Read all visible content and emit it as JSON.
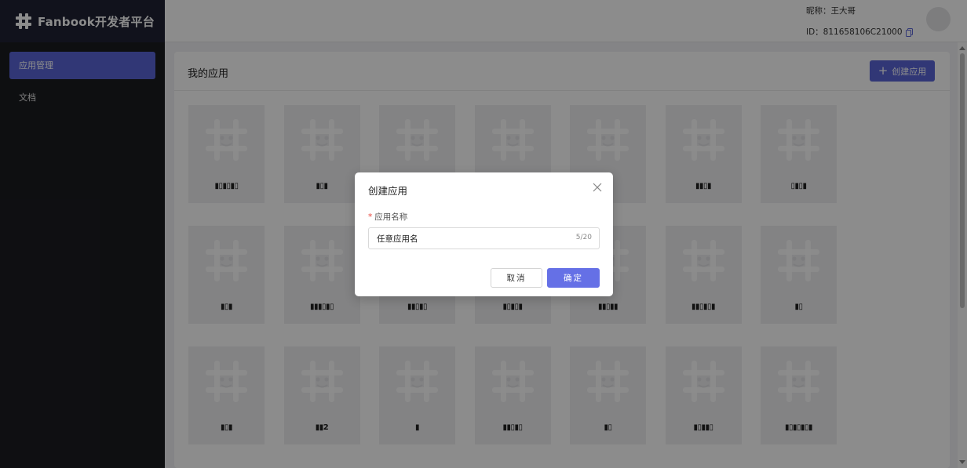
{
  "app": {
    "brand": "Fanbook开发者平台"
  },
  "sidebar": {
    "items": [
      {
        "label": "应用管理",
        "active": true
      },
      {
        "label": "文档",
        "active": false
      }
    ]
  },
  "header": {
    "nickname": "昵称：王大哥",
    "user_id": "ID：811658106C21000"
  },
  "main": {
    "title": "我的应用",
    "create_button": "创建应用",
    "apps": [
      {
        "name": "▮▯▮▯▮▯",
        "pixelated": true
      },
      {
        "name": "▮▯▮",
        "pixelated": true
      },
      {
        "name": "",
        "pixelated": true
      },
      {
        "name": "",
        "pixelated": true
      },
      {
        "name": "",
        "pixelated": true
      },
      {
        "name": "▮▮▯▮",
        "pixelated": true
      },
      {
        "name": "▯▮▯▮",
        "pixelated": true
      },
      {
        "name": "▮▯▮",
        "pixelated": true
      },
      {
        "name": "▮▮▮▯▮▯",
        "pixelated": true
      },
      {
        "name": "▮▮▯▮▯",
        "pixelated": true
      },
      {
        "name": "▮▯▮▯▮",
        "pixelated": true
      },
      {
        "name": "▮▮▯▮▮",
        "pixelated": true
      },
      {
        "name": "▮▮▯▮▯▮",
        "pixelated": true
      },
      {
        "name": "▮▯",
        "pixelated": true
      },
      {
        "name": "▮▯▮",
        "pixelated": true
      },
      {
        "name": "▮▮2",
        "pixelated": true
      },
      {
        "name": "▮",
        "pixelated": true
      },
      {
        "name": "▮▮▯▮▯",
        "pixelated": true
      },
      {
        "name": "▮▯",
        "pixelated": true
      },
      {
        "name": "▮▯▮▮▯",
        "pixelated": true
      },
      {
        "name": "▮▯▮▯▮▯▮",
        "pixelated": true
      }
    ]
  },
  "modal": {
    "title": "创建应用",
    "field_label": "应用名称",
    "required_mark": "*",
    "input_value": "任意应用名",
    "char_count": "5/20",
    "cancel_label": "取消",
    "ok_label": "确定"
  },
  "colors": {
    "accent": "#5965d8",
    "sidebar_bg": "#1b1c20",
    "card_bg": "#eeeef0"
  }
}
